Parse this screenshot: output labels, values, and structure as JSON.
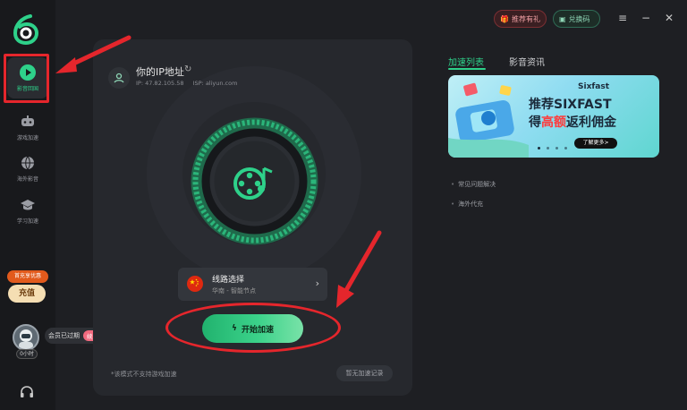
{
  "sidebar": {
    "items": [
      {
        "label": "影音回国",
        "icon": "play-icon"
      },
      {
        "label": "游戏加速",
        "icon": "gamepad-icon"
      },
      {
        "label": "海外影音",
        "icon": "globe-icon"
      },
      {
        "label": "学习加速",
        "icon": "graduation-cap-icon"
      }
    ],
    "promo_tag": "首充享优惠",
    "recharge_label": "充值",
    "member_status": "会员已过期",
    "renew_label": "续费",
    "hours": "0小时"
  },
  "topbar": {
    "gift_label": "推荐有礼",
    "code_label": "兑换码"
  },
  "ip": {
    "title": "你的IP地址",
    "ip_label": "IP: 47.82.105.58",
    "isp_label": "ISP: aliyun.com"
  },
  "route": {
    "title": "线路选择",
    "subtitle": "华南 - 智能节点"
  },
  "start_label": "开始加速",
  "footer": {
    "note": "*该模式不支持游戏加速",
    "record_label": "暂无加速记录"
  },
  "tabs": [
    {
      "label": "加速列表",
      "active": true
    },
    {
      "label": "影音资讯",
      "active": false
    }
  ],
  "banner": {
    "brand": "Sixfast",
    "line1": "推荐SIXFAST",
    "line2_a": "得",
    "line2_hot": "高额",
    "line2_b": "返利佣金",
    "more": "了解更多>"
  },
  "links": [
    "常见问题解决",
    "海外代充"
  ],
  "colors": {
    "accent": "#2ed18a",
    "annotation_red": "#e5262c",
    "background": "#1e1f23"
  }
}
